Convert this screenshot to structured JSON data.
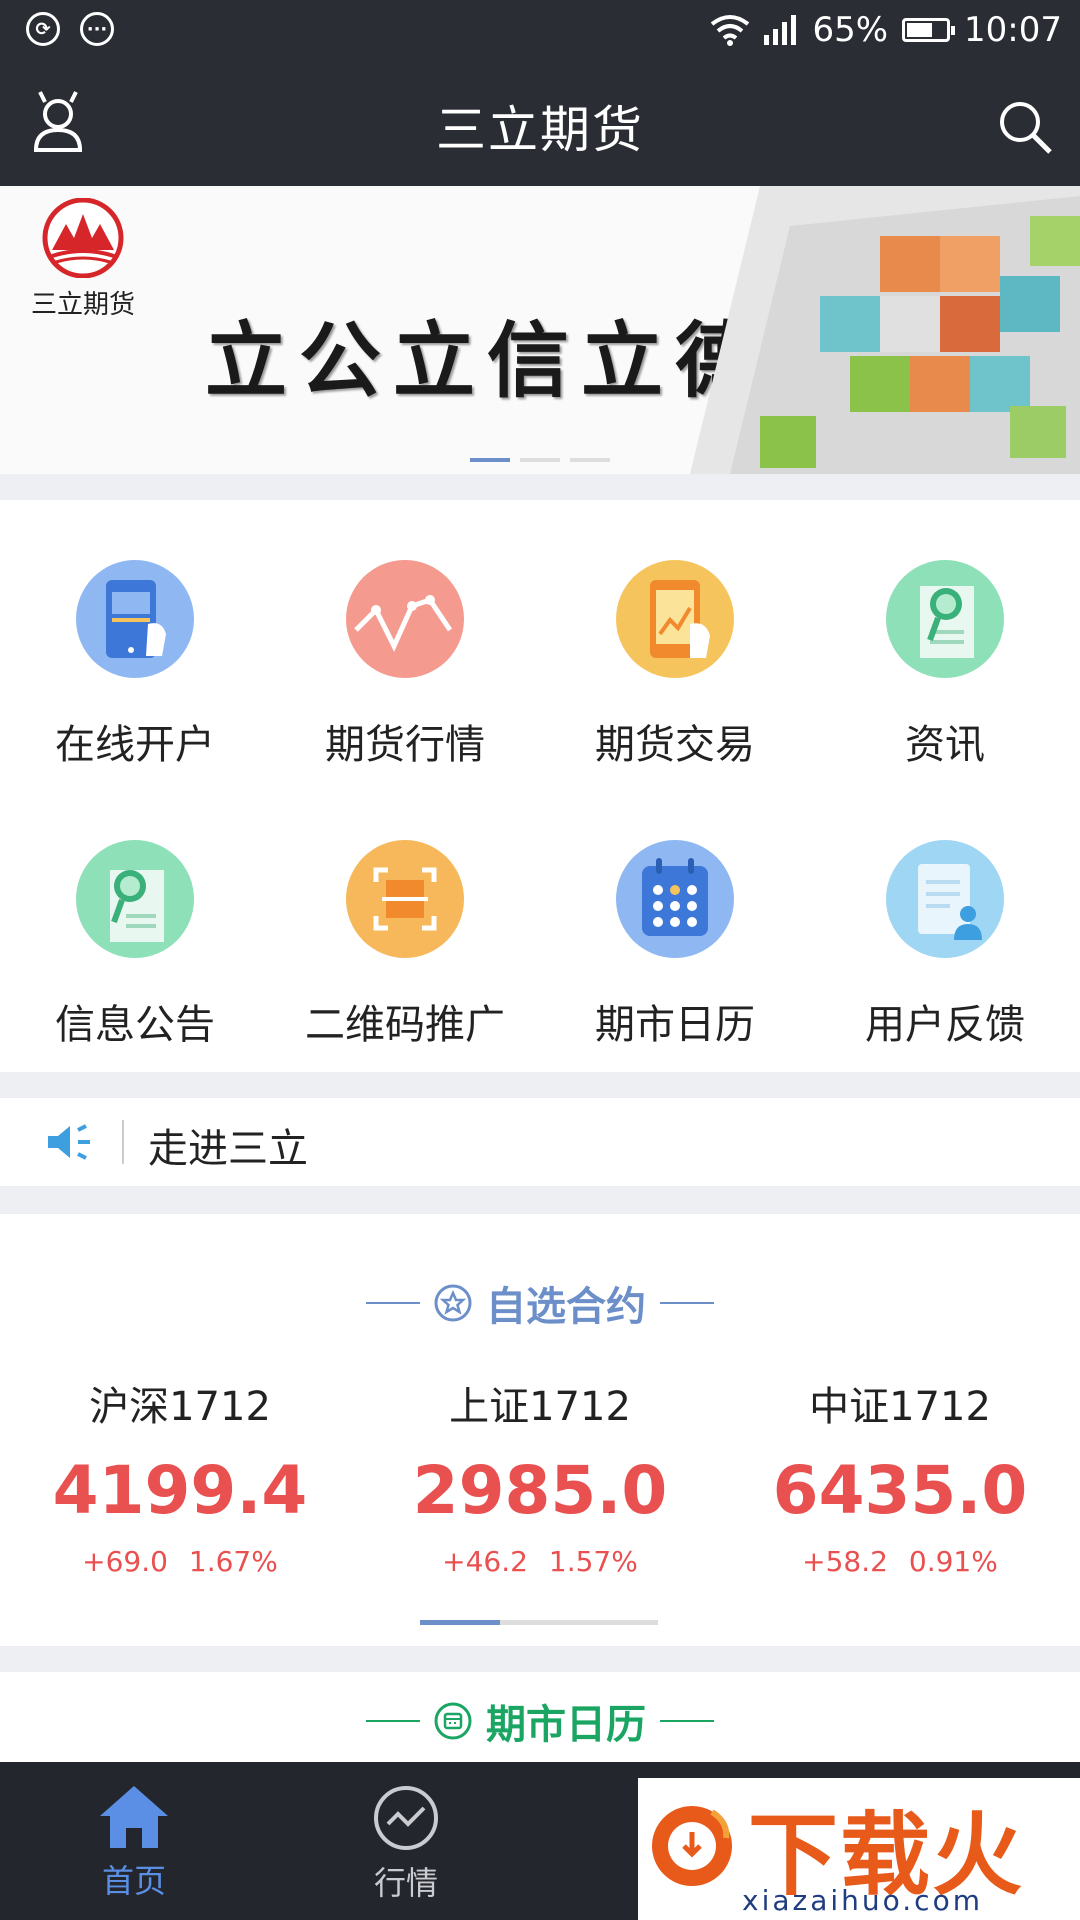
{
  "status_bar": {
    "battery_percent": "65%",
    "time": "10:07",
    "battery_level": 0.65
  },
  "header": {
    "title": "三立期货"
  },
  "banner": {
    "logo_text": "三立期货",
    "slogan": "立公立信立德",
    "slide_count": 3,
    "active_slide": 1
  },
  "quick_menu": {
    "items": [
      {
        "label": "在线开户",
        "icon": "online-account-icon",
        "color": "#8fb8f3"
      },
      {
        "label": "期货行情",
        "icon": "futures-quotes-icon",
        "color": "#f59a8f"
      },
      {
        "label": "期货交易",
        "icon": "futures-trading-icon",
        "color": "#f6c45c"
      },
      {
        "label": "资讯",
        "icon": "news-icon",
        "color": "#8de0b8"
      },
      {
        "label": "信息公告",
        "icon": "announcement-icon",
        "color": "#8de0b8"
      },
      {
        "label": "二维码推广",
        "icon": "qrcode-promo-icon",
        "color": "#f6b85a"
      },
      {
        "label": "期市日历",
        "icon": "calendar-icon",
        "color": "#8fb8f3"
      },
      {
        "label": "用户反馈",
        "icon": "feedback-icon",
        "color": "#9ed6f3"
      }
    ]
  },
  "notice": {
    "text": "走进三立"
  },
  "watchlist": {
    "title": "自选合约",
    "accent": "#6c8fc9",
    "contracts": [
      {
        "name": "沪深1712",
        "price": "4199.4",
        "change": "+69.0",
        "percent": "1.67%"
      },
      {
        "name": "上证1712",
        "price": "2985.0",
        "change": "+46.2",
        "percent": "1.57%"
      },
      {
        "name": "中证1712",
        "price": "6435.0",
        "change": "+58.2",
        "percent": "0.91%"
      }
    ],
    "up_color": "#e95050"
  },
  "calendar_section": {
    "title": "期市日历",
    "accent": "#1aa562"
  },
  "tabbar": {
    "tabs": [
      {
        "label": "首页",
        "active": true
      },
      {
        "label": "行情",
        "active": false
      }
    ],
    "active_color": "#5b8fe6"
  },
  "watermark": {
    "main": "下载火",
    "sub": "xiazaihuo.com"
  }
}
